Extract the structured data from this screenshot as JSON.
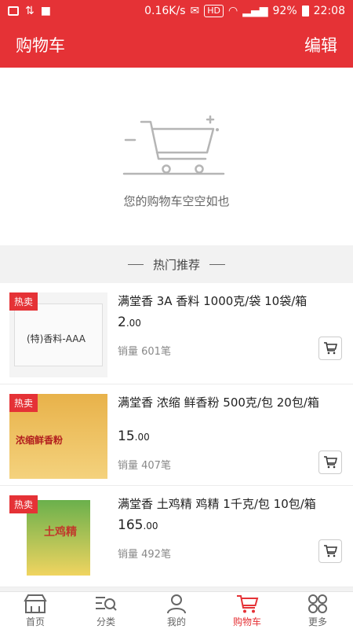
{
  "statusbar": {
    "speed": "0.16K/s",
    "hd": "HD",
    "battery": "92%",
    "time": "22:08"
  },
  "header": {
    "title": "购物车",
    "edit": "编辑"
  },
  "empty": {
    "message": "您的购物车空空如也"
  },
  "hot": {
    "title": "热门推荐"
  },
  "products": [
    {
      "badge": "热卖",
      "name": "满堂香 3A 香料 1000克/袋 10袋/箱",
      "price_int": "2",
      "price_dec": ".00",
      "sold": "销量 601笔",
      "image_text": "(特)香料-AAA"
    },
    {
      "badge": "热卖",
      "name": "满堂香  浓缩  鲜香粉  500克/包  20包/箱",
      "price_int": "15",
      "price_dec": ".00",
      "sold": "销量 407笔",
      "image_text": "浓缩鲜香粉"
    },
    {
      "badge": "热卖",
      "name": "满堂香 土鸡精 鸡精 1千克/包 10包/箱",
      "price_int": "165",
      "price_dec": ".00",
      "sold": "销量 492笔",
      "image_text": "土鸡精"
    }
  ],
  "tabs": [
    {
      "label": "首页",
      "icon": "store-icon"
    },
    {
      "label": "分类",
      "icon": "category-search-icon"
    },
    {
      "label": "我的",
      "icon": "person-icon"
    },
    {
      "label": "购物车",
      "icon": "cart-icon"
    },
    {
      "label": "更多",
      "icon": "grid-icon"
    }
  ],
  "colors": {
    "brand": "#e53236"
  }
}
